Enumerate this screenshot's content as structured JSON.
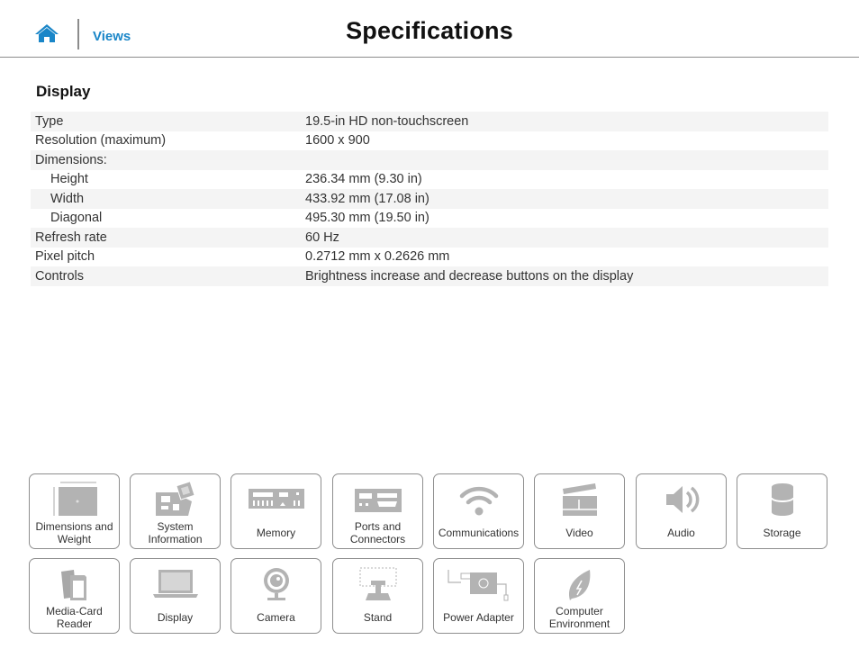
{
  "header": {
    "home_icon": "home-icon",
    "views_link": "Views",
    "title": "Specifications",
    "accent_color": "#1a86c8"
  },
  "section": {
    "title": "Display"
  },
  "specs": [
    {
      "label": "Type",
      "value": "19.5-in HD non-touchscreen",
      "indent": false
    },
    {
      "label": "Resolution (maximum)",
      "value": "1600 x 900",
      "indent": false
    },
    {
      "label": "Dimensions:",
      "value": "",
      "indent": false
    },
    {
      "label": "Height",
      "value": "236.34 mm (9.30 in)",
      "indent": true
    },
    {
      "label": "Width",
      "value": "433.92 mm (17.08 in)",
      "indent": true
    },
    {
      "label": "Diagonal",
      "value": "495.30 mm (19.50 in)",
      "indent": true
    },
    {
      "label": "Refresh rate",
      "value": "60 Hz",
      "indent": false
    },
    {
      "label": "Pixel pitch",
      "value": "0.2712 mm x 0.2626 mm",
      "indent": false
    },
    {
      "label": "Controls",
      "value": "Brightness increase and decrease buttons on the display",
      "indent": false
    }
  ],
  "tiles": [
    {
      "label": "Dimensions and Weight",
      "icon": "dimensions-icon"
    },
    {
      "label": "System Information",
      "icon": "system-board-icon"
    },
    {
      "label": "Memory",
      "icon": "memory-icon"
    },
    {
      "label": "Ports and Connectors",
      "icon": "ports-icon"
    },
    {
      "label": "Communications",
      "icon": "wifi-icon"
    },
    {
      "label": "Video",
      "icon": "clapperboard-icon"
    },
    {
      "label": "Audio",
      "icon": "speaker-icon"
    },
    {
      "label": "Storage",
      "icon": "storage-cylinder-icon"
    },
    {
      "label": "Media-Card Reader",
      "icon": "media-card-icon"
    },
    {
      "label": "Display",
      "icon": "laptop-display-icon"
    },
    {
      "label": "Camera",
      "icon": "webcam-icon"
    },
    {
      "label": "Stand",
      "icon": "stand-icon"
    },
    {
      "label": "Power Adapter",
      "icon": "power-adapter-icon"
    },
    {
      "label": "Computer Environment",
      "icon": "leaf-icon"
    }
  ]
}
